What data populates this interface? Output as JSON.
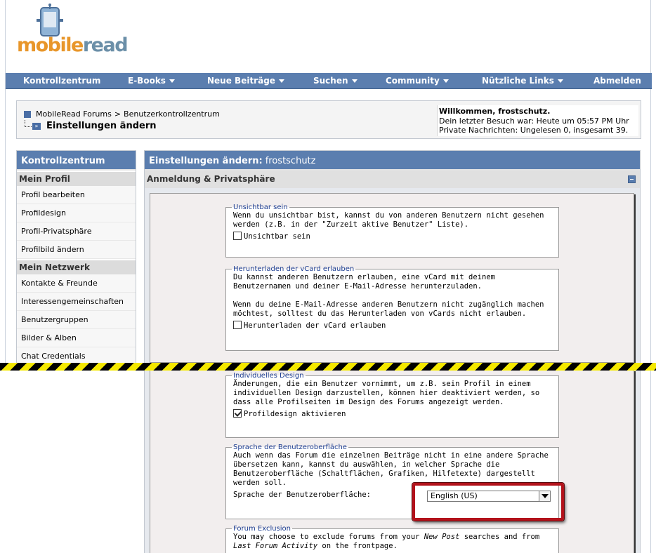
{
  "logo": {
    "part1": "mobile",
    "part2": "read"
  },
  "navbar": [
    {
      "label": "Kontrollzentrum",
      "dropdown": false
    },
    {
      "label": "E-Books",
      "dropdown": true
    },
    {
      "label": "Neue Beiträge",
      "dropdown": true
    },
    {
      "label": "Suchen",
      "dropdown": true
    },
    {
      "label": "Community",
      "dropdown": true
    },
    {
      "label": "Nützliche Links",
      "dropdown": true
    },
    {
      "label": "Abmelden",
      "dropdown": false
    }
  ],
  "breadcrumb": {
    "root": "MobileRead Forums",
    "separator": ">",
    "parent": "Benutzerkontrollzentrum",
    "current": "Einstellungen ändern"
  },
  "welcome": {
    "title": "Willkommen, frostschutz.",
    "last_visit": "Dein letzter Besuch war: Heute um 05:57 PM Uhr",
    "messages": "Private Nachrichten: Ungelesen 0, insgesamt 39."
  },
  "sidebar": {
    "title": "Kontrollzentrum",
    "sections": [
      {
        "heading": "Mein Profil",
        "items": [
          "Profil bearbeiten",
          "Profildesign",
          "Profil-Privatsphäre",
          "Profilbild ändern"
        ]
      },
      {
        "heading": "Mein Netzwerk",
        "items": [
          "Kontakte & Freunde",
          "Interessengemeinschaften",
          "Benutzergruppen",
          "Bilder & Alben",
          "Chat Credentials"
        ]
      }
    ]
  },
  "main": {
    "title": "Einstellungen ändern:",
    "username": "frostschutz",
    "subheader": "Anmeldung & Privatsphäre",
    "invisible": {
      "legend": "Unsichtbar sein",
      "text": "Wenn du unsichtbar bist, kannst du von anderen Benutzern nicht gesehen werden (z.B. in der \"Zurzeit aktive Benutzer\" Liste).",
      "checkbox_label": "Unsichtbar sein",
      "checked": false
    },
    "vcard": {
      "legend": "Herunterladen der vCard erlauben",
      "text1": "Du kannst anderen Benutzern erlauben, eine vCard mit deinem Benutzernamen und deiner E-Mail-Adresse herunterzuladen.",
      "text2": "Wenn du deine E-Mail-Adresse anderen Benutzern nicht zugänglich machen möchtest, solltest du das Herunterladen von vCards nicht erlauben.",
      "checkbox_label": "Herunterladen der vCard erlauben",
      "checked": false
    },
    "design": {
      "legend": "Individuelles Design",
      "text": "Änderungen, die ein Benutzer vornimmt, um z.B. sein Profil in einem individuellen Design darzustellen, können hier deaktiviert werden, so dass alle Profilseiten im Design des Forums angezeigt werden.",
      "checkbox_label": "Profildesign aktivieren",
      "checked": true
    },
    "language": {
      "legend": "Sprache der Benutzeroberfläche",
      "text": "Auch wenn das Forum die einzelnen Beiträge nicht in eine andere Sprache übersetzen kann, kannst du auswählen, in welcher Sprache die Benutzeroberfläche (Schaltflächen, Grafiken, Hilfetexte) dargestellt werden soll.",
      "select_label": "Sprache der Benutzeroberfläche:",
      "selected": "English (US)"
    },
    "exclusion": {
      "legend": "Forum Exclusion",
      "text_a": "You may choose to exclude forums from your ",
      "text_em1": "New Post",
      "text_b": " searches and from ",
      "text_em2": "Last Forum Activity",
      "text_c": " on the frontpage."
    }
  }
}
